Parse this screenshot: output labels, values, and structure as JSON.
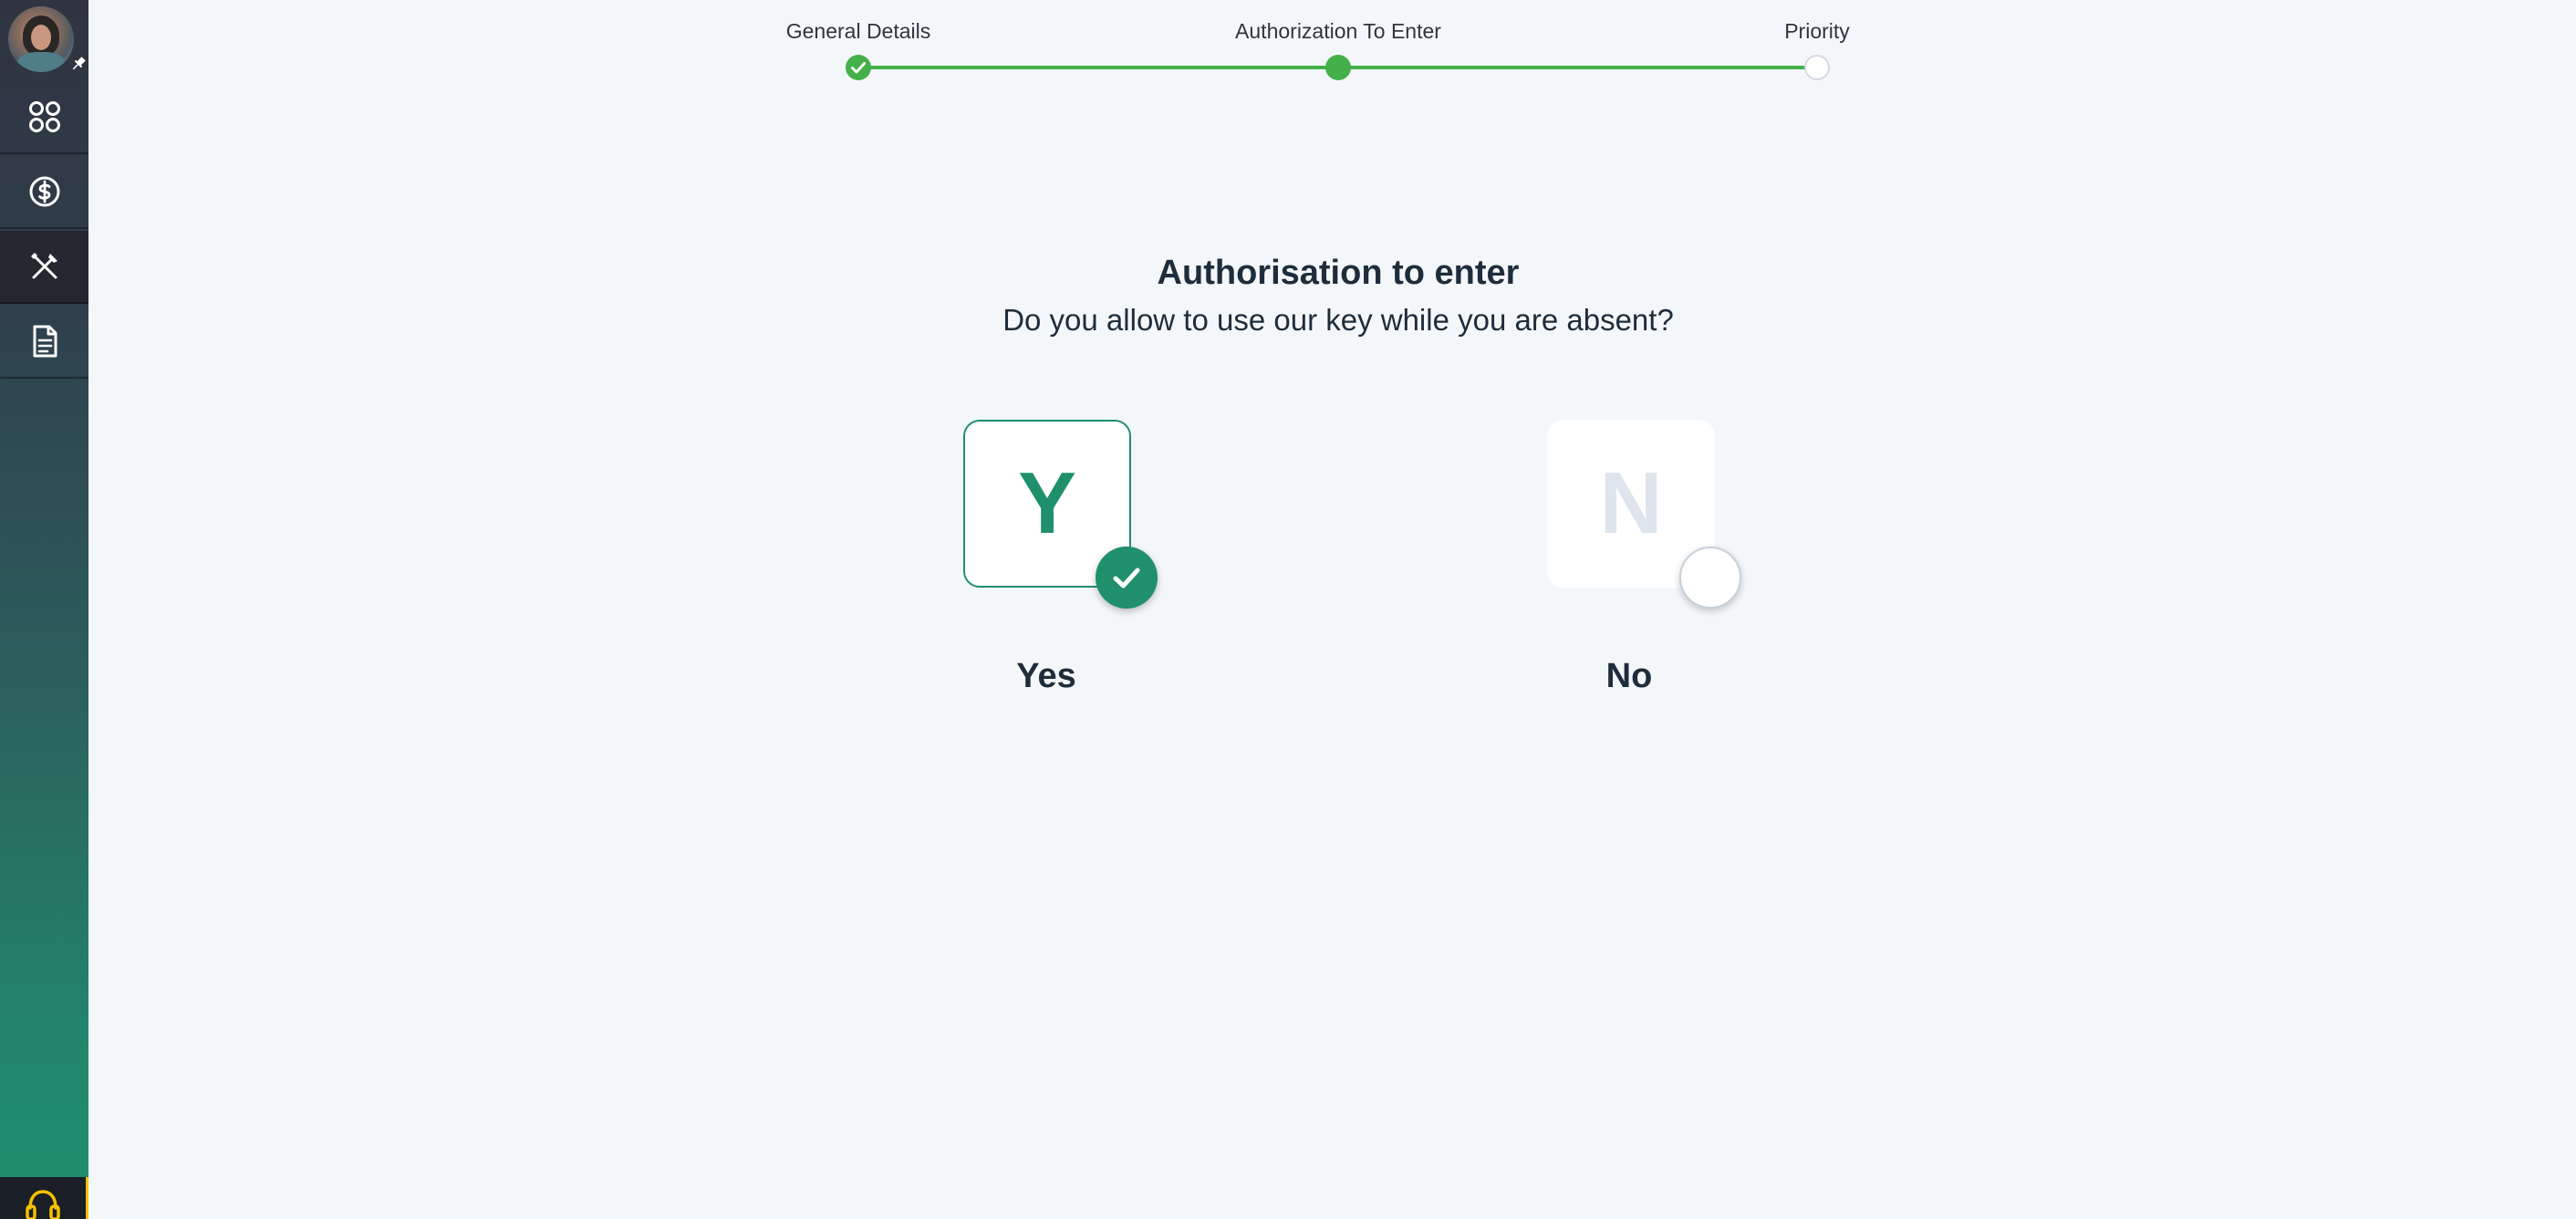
{
  "sidebar": {
    "avatar_icon": "user-avatar",
    "items": [
      {
        "icon": "dashboard-grid-icon",
        "active": false
      },
      {
        "icon": "dollar-circle-icon",
        "active": false
      },
      {
        "icon": "tools-icon",
        "active": true
      },
      {
        "icon": "document-icon",
        "active": false
      }
    ],
    "support_icon": "headset-icon"
  },
  "stepper": {
    "steps": [
      {
        "label": "General Details",
        "state": "done"
      },
      {
        "label": "Authorization To Enter",
        "state": "current"
      },
      {
        "label": "Priority",
        "state": "todo"
      }
    ],
    "accent_color": "#43b049"
  },
  "main": {
    "title": "Authorisation to enter",
    "question": "Do you allow to use our key while you are absent?",
    "options": [
      {
        "letter": "Y",
        "label": "Yes",
        "selected": true
      },
      {
        "letter": "N",
        "label": "No",
        "selected": false
      }
    ],
    "selected_color": "#1f8f6c"
  }
}
